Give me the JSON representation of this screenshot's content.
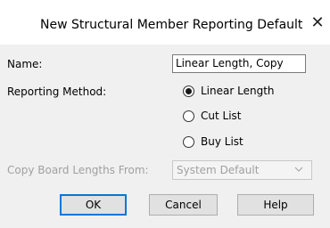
{
  "window": {
    "title": "New Structural Member Reporting Default",
    "close_symbol": "✕",
    "close_icon": "close-icon"
  },
  "form": {
    "name_label": "Name:",
    "name_value": "Linear Length, Copy",
    "reporting_label": "Reporting Method:",
    "reporting_options": [
      {
        "label": "Linear Length",
        "selected": true
      },
      {
        "label": "Cut List",
        "selected": false
      },
      {
        "label": "Buy List",
        "selected": false
      }
    ],
    "copy_label": "Copy Board Lengths From:",
    "copy_value": "System Default",
    "copy_enabled": false
  },
  "buttons": {
    "ok": "OK",
    "cancel": "Cancel",
    "help": "Help"
  },
  "colors": {
    "accent": "#0078d7",
    "disabled_text": "#a0a0a0",
    "dialog_bg": "#f0f0f0"
  }
}
